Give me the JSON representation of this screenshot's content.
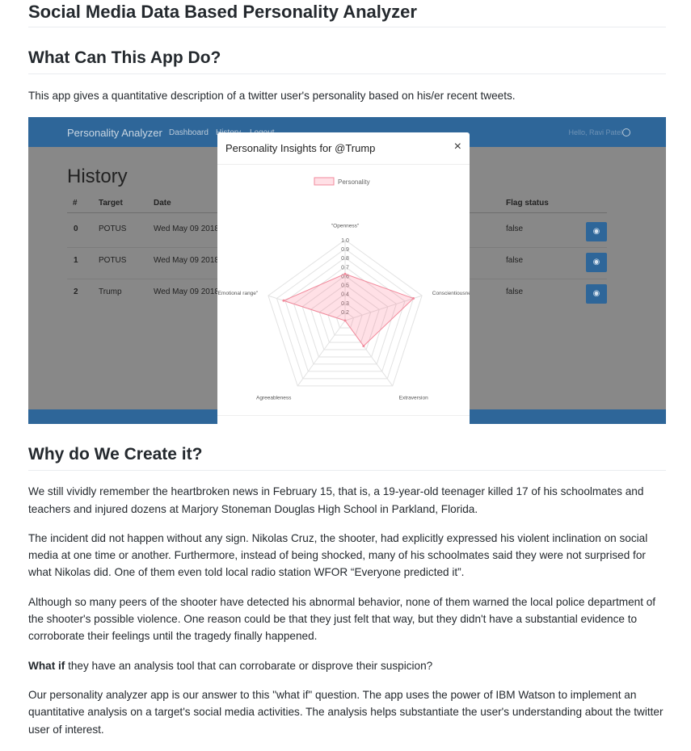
{
  "title": "Social Media Data Based Personality Analyzer",
  "section1": {
    "heading": "What Can This App Do?",
    "text": "This app gives a quantitative description of a twitter user's personality based on his/er recent tweets."
  },
  "screenshot": {
    "navbar": {
      "brand": "Personality Analyzer",
      "links": [
        "Dashboard",
        "History",
        "Logout"
      ],
      "greeting": "Hello, Ravi Patel"
    },
    "page_title": "History",
    "table": {
      "headers": [
        "#",
        "Target",
        "Date",
        "Flag status"
      ],
      "rows": [
        {
          "index": "0",
          "target": "POTUS",
          "date": "Wed May 09 2018",
          "flag": "false"
        },
        {
          "index": "1",
          "target": "POTUS",
          "date": "Wed May 09 2018",
          "flag": "false"
        },
        {
          "index": "2",
          "target": "Trump",
          "date": "Wed May 09 2018",
          "flag": "false"
        }
      ],
      "action_icon": "eye-icon"
    },
    "modal": {
      "title": "Personality Insights for @Trump",
      "close": "×"
    },
    "colors": {
      "navbar": "#2e6699",
      "radar_fill": "rgba(255,99,132,0.2)",
      "radar_line": "#f28a9c"
    }
  },
  "chart_data": {
    "type": "radar",
    "legend": "Personality",
    "axes": [
      "\"Openness\"",
      "Conscientiousness",
      "Extraversion",
      "Agreeableness",
      "\"Emotional range\""
    ],
    "series": [
      {
        "name": "Personality",
        "values": [
          0.62,
          0.9,
          0.45,
          0.02,
          0.82
        ]
      }
    ],
    "ticks": [
      "0.2",
      "0.3",
      "0.4",
      "0.5",
      "0.6",
      "0.7",
      "0.8",
      "0.9",
      "1.0"
    ],
    "range": [
      0.1,
      1.0
    ]
  },
  "section2": {
    "heading": "Why do We Create it?",
    "p1": "We still vividly remember the heartbroken news in February 15, that is, a 19-year-old teenager killed 17 of his schoolmates and teachers and injured dozens at Marjory Stoneman Douglas High School in Parkland, Florida.",
    "p2": "The incident did not happen without any sign. Nikolas Cruz, the shooter, had explicitly expressed his violent inclination on social media at one time or another. Furthermore, instead of being shocked, many of his schoolmates said they were not surprised for what Nikolas did. One of them even told local radio station WFOR “Everyone predicted it”.",
    "p3": "Although so many peers of the shooter have detected his abnormal behavior, none of them warned the local police department of the shooter's possible violence. One reason could be that they just felt that way, but they didn't have a substantial evidence to corroborate their feelings until the tragedy finally happened.",
    "p4_bold": "What if",
    "p4_rest": " they have an analysis tool that can corrobarate or disprove their suspicion?",
    "p5": "Our personality analyzer app is our answer to this \"what if\" question. The app uses the power of IBM Watson to implement an quantitative analysis on a target's social media activities. The analysis helps substantiate the user's understanding about the twitter user of interest."
  }
}
